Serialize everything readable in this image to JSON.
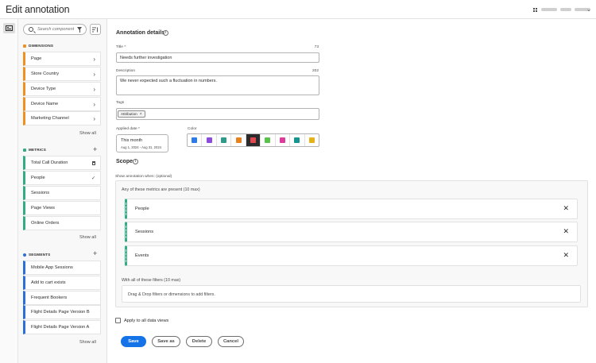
{
  "header": {
    "title": "Edit annotation"
  },
  "panel": {
    "search_placeholder": "Search component",
    "sections": {
      "dimensions": {
        "title": "DIMENSIONS",
        "color": "#f09021",
        "items": [
          "Page",
          "Store Country",
          "Device Type",
          "Device Name",
          "Marketing Channel"
        ],
        "show_all": "Show all"
      },
      "metrics": {
        "title": "METRICS",
        "color": "#33ab84",
        "items": [
          "Total Call Duration",
          "People",
          "Sessions",
          "Page Views",
          "Online Orders"
        ],
        "show_all": "Show all"
      },
      "segments": {
        "title": "SEGMENTS",
        "color": "#2d6fd9",
        "items": [
          "Mobile App Sessions",
          "Add to cart exists",
          "Frequent Bookers",
          "Flight Details Page Version B",
          "Flight Details Page Version A"
        ],
        "show_all": "Show all"
      }
    }
  },
  "details": {
    "heading": "Annotation details",
    "title_label": "Title",
    "title_count": "73",
    "title_value": "Needs further investigation",
    "description_label": "Description",
    "description_count": "202",
    "description_value": "We never expected such a fluctuation in numbers.",
    "tags_label": "Tags",
    "tag": "Attribution",
    "applied_date_label": "Applied date",
    "date_preset": "This month",
    "date_range": "Aug 1, 2024 - Aug 31, 2024",
    "color_label": "Color",
    "colors": [
      "#2d7be5",
      "#8d4bdc",
      "#2e9a8a",
      "#e8821f",
      "#e34850",
      "#58c24a",
      "#dc3c9b",
      "#16948f",
      "#e6b21a"
    ],
    "selected_color_index": 4
  },
  "scope": {
    "heading": "Scope",
    "optional": "Show annotation when: (optional)",
    "metrics_title": "Any of these metrics are present (10 max)",
    "metrics": [
      "People",
      "Sessions",
      "Events"
    ],
    "filters_title": "With all of these filters (10 max)",
    "filters_placeholder": "Drag & Drop filters or dimensions to add filters."
  },
  "apply_all": "Apply to all data views",
  "buttons": {
    "save": "Save",
    "save_as": "Save as",
    "delete": "Delete",
    "cancel": "Cancel"
  }
}
